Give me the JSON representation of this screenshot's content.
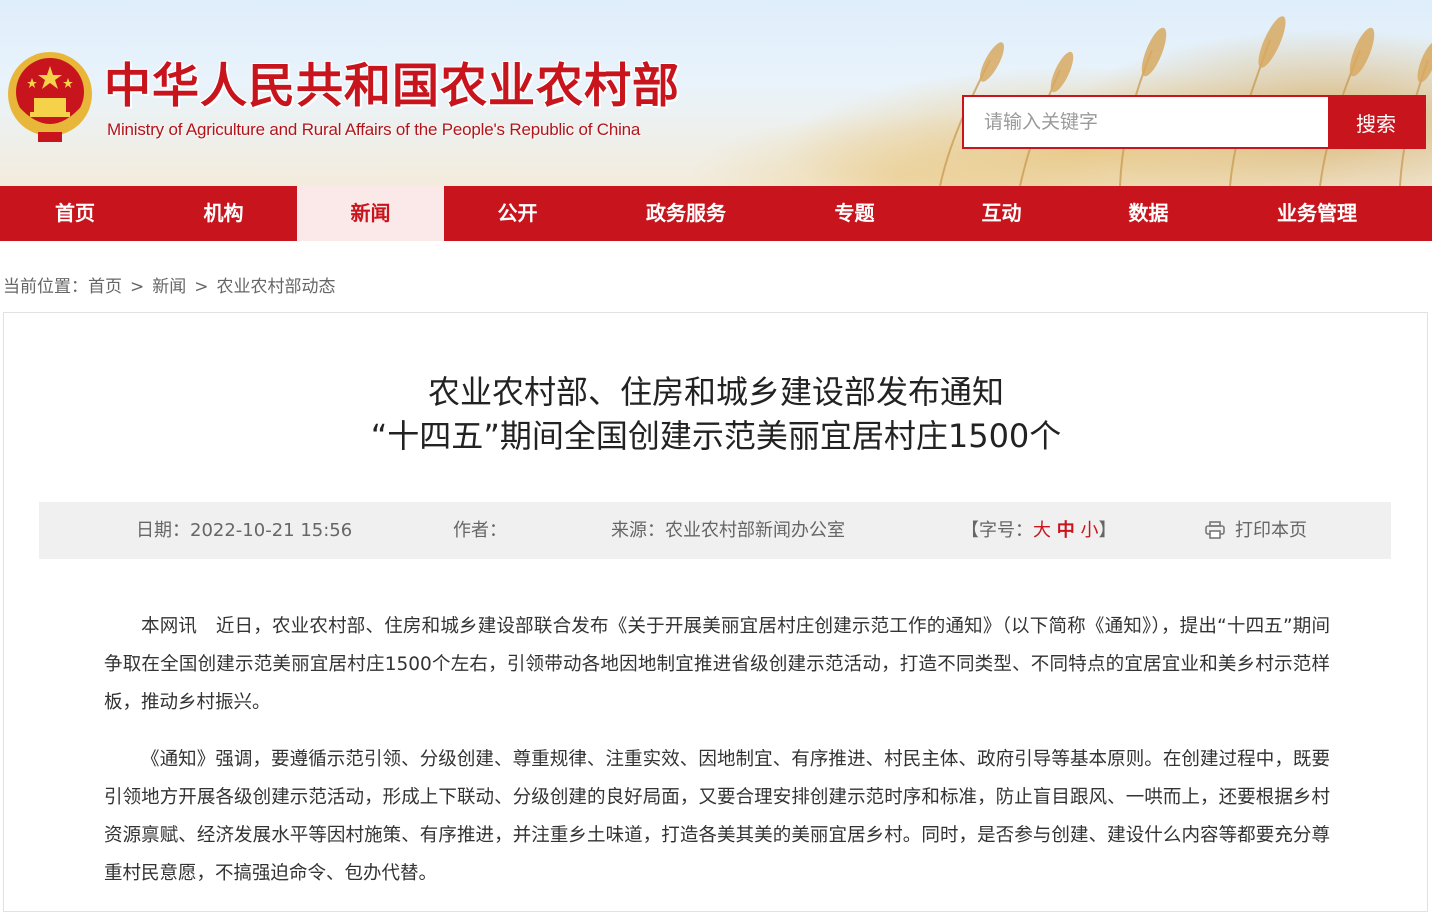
{
  "header": {
    "title_cn": "中华人民共和国农业农村部",
    "title_en": "Ministry of Agriculture and Rural Affairs of the People's Republic of China",
    "search": {
      "placeholder": "请输入关键字",
      "button_label": "搜索"
    },
    "colors": {
      "brand_red": "#c8141c",
      "nav_active_bg": "#fbe9e9"
    }
  },
  "nav": {
    "items": [
      {
        "label": "首页"
      },
      {
        "label": "机构"
      },
      {
        "label": "新闻",
        "active": true
      },
      {
        "label": "公开"
      },
      {
        "label": "政务服务"
      },
      {
        "label": "专题"
      },
      {
        "label": "互动"
      },
      {
        "label": "数据"
      },
      {
        "label": "业务管理"
      }
    ]
  },
  "breadcrumb": {
    "prefix": "当前位置：",
    "items": [
      "首页",
      "新闻",
      "农业农村部动态"
    ],
    "separator": ">"
  },
  "article": {
    "title_line1": "农业农村部、住房和城乡建设部发布通知",
    "title_line2": "“十四五”期间全国创建示范美丽宜居村庄1500个",
    "meta": {
      "date_label": "日期：",
      "date": "2022-10-21 15:56",
      "author_label": "作者：",
      "author": "",
      "source_label": "来源：",
      "source": "农业农村部新闻办公室",
      "font_label": "【字号：",
      "font_big": "大",
      "font_mid": "中",
      "font_small": "小",
      "font_end": "】",
      "print_label": "打印本页",
      "print_icon": "printer-icon"
    },
    "paragraphs": [
      "本网讯　近日，农业农村部、住房和城乡建设部联合发布《关于开展美丽宜居村庄创建示范工作的通知》（以下简称《通知》），提出“十四五”期间争取在全国创建示范美丽宜居村庄1500个左右，引领带动各地因地制宜推进省级创建示范活动，打造不同类型、不同特点的宜居宜业和美乡村示范样板，推动乡村振兴。",
      "《通知》强调，要遵循示范引领、分级创建、尊重规律、注重实效、因地制宜、有序推进、村民主体、政府引导等基本原则。在创建过程中，既要引领地方开展各级创建示范活动，形成上下联动、分级创建的良好局面，又要合理安排创建示范时序和标准，防止盲目跟风、一哄而上，还要根据乡村资源禀赋、经济发展水平等因村施策、有序推进，并注重乡土味道，打造各美其美的美丽宜居乡村。同时，是否参与创建、建设什么内容等都要充分尊重村民意愿，不搞强迫命令、包办代替。"
    ]
  }
}
